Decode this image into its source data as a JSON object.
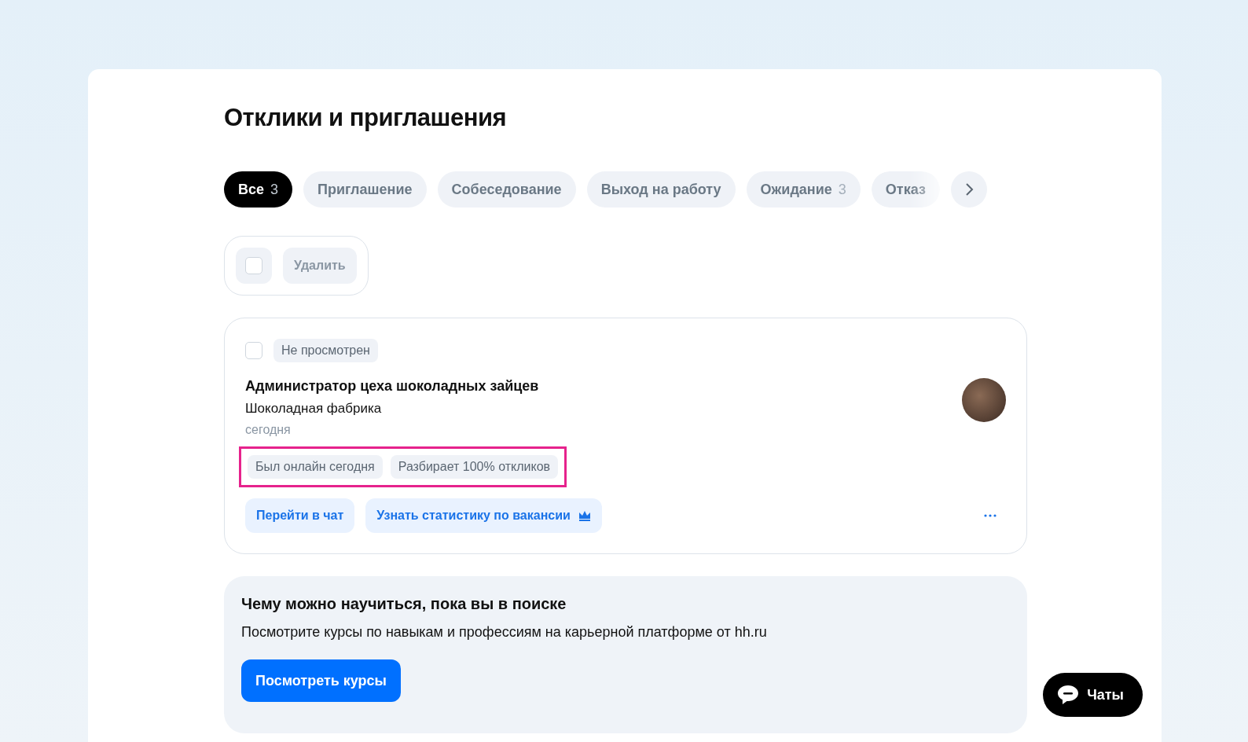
{
  "title": "Отклики и приглашения",
  "tabs": [
    {
      "label": "Все",
      "count": "3",
      "selected": true
    },
    {
      "label": "Приглашение",
      "selected": false
    },
    {
      "label": "Собеседование",
      "selected": false
    },
    {
      "label": "Выход на работу",
      "selected": false
    },
    {
      "label": "Ожидание",
      "count": "3",
      "selected": false
    },
    {
      "label": "Отказ",
      "selected": false
    }
  ],
  "bulk": {
    "checked": false,
    "delete_label": "Удалить"
  },
  "responses": [
    {
      "checked": false,
      "status": "Не просмотрен",
      "vacancy": "Администратор цеха шоколадных зайцев",
      "company": "Шоколадная фабрика",
      "date": "сегодня",
      "tags": [
        "Был онлайн сегодня",
        "Разбирает 100% откликов"
      ],
      "tags_highlighted": true,
      "actions": [
        {
          "label": "Перейти в чат",
          "premium": false
        },
        {
          "label": "Узнать статистику по вакансии",
          "premium": true
        }
      ]
    }
  ],
  "promo": {
    "title": "Чему можно научиться, пока вы в поиске",
    "text": "Посмотрите курсы по навыкам и профессиям на карьерной платформе от hh.ru",
    "button": "Посмотреть курсы"
  },
  "chats_button": "Чаты"
}
